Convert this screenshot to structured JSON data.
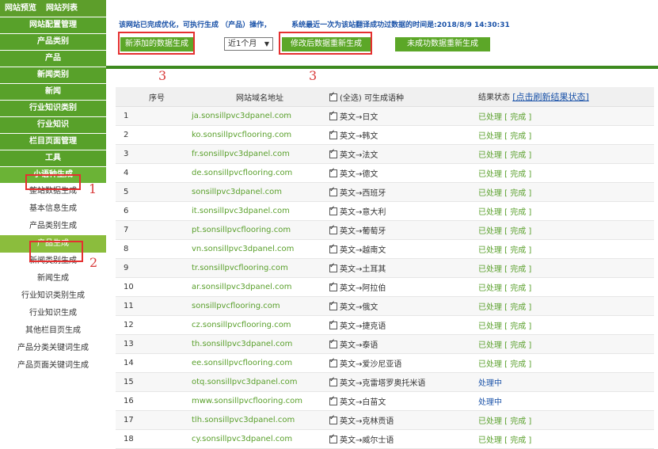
{
  "sidebar": {
    "tabs": [
      "网站预览",
      "网站列表"
    ],
    "groups": [
      "网站配置管理",
      "产品类别",
      "产品",
      "新闻类别",
      "新闻",
      "行业知识类别",
      "行业知识",
      "栏目页面管理",
      "工具",
      "小语种生成"
    ],
    "items": [
      "整站数据生成",
      "基本信息生成",
      "产品类别生成",
      "产品生成",
      "新闻类别生成",
      "新闻生成",
      "行业知识类别生成",
      "行业知识生成",
      "其他栏目页生成",
      "产品分类关键词生成",
      "产品页面关键词生成"
    ]
  },
  "notice": {
    "part1": "该网站已完成优化，可执行生成 （产品）操作，",
    "part2": "系统最近一次为该站翻译成功过数据的时间是:2018/8/9 14:30:31"
  },
  "toolbar": {
    "new_btn": "新添加的数据生成",
    "period": "近1个月",
    "modified_btn": "修改后数据重新生成",
    "failed_btn": "未成功数据重新生成"
  },
  "annotations": {
    "n1": "1",
    "n2": "2",
    "n3a": "3",
    "n3b": "3"
  },
  "table": {
    "headers": {
      "no": "序号",
      "domain": "网站域名地址",
      "langs": "(全选) 可生成语种",
      "status": "结果状态",
      "refresh": "[点击刷新结果状态]"
    },
    "rows": [
      {
        "no": "1",
        "domain": "ja.sonsillpvc3dpanel.com",
        "lang": "英文→日文",
        "status": "已处理 [ 完成 ]"
      },
      {
        "no": "2",
        "domain": "ko.sonsillpvcflooring.com",
        "lang": "英文→韩文",
        "status": "已处理 [ 完成 ]"
      },
      {
        "no": "3",
        "domain": "fr.sonsillpvc3dpanel.com",
        "lang": "英文→法文",
        "status": "已处理 [ 完成 ]"
      },
      {
        "no": "4",
        "domain": "de.sonsillpvcflooring.com",
        "lang": "英文→德文",
        "status": "已处理 [ 完成 ]"
      },
      {
        "no": "5",
        "domain": "sonsillpvc3dpanel.com",
        "lang": "英文→西班牙",
        "status": "已处理 [ 完成 ]"
      },
      {
        "no": "6",
        "domain": "it.sonsillpvc3dpanel.com",
        "lang": "英文→意大利",
        "status": "已处理 [ 完成 ]"
      },
      {
        "no": "7",
        "domain": "pt.sonsillpvcflooring.com",
        "lang": "英文→葡萄牙",
        "status": "已处理 [ 完成 ]"
      },
      {
        "no": "8",
        "domain": "vn.sonsillpvc3dpanel.com",
        "lang": "英文→越南文",
        "status": "已处理 [ 完成 ]"
      },
      {
        "no": "9",
        "domain": "tr.sonsillpvcflooring.com",
        "lang": "英文→土耳其",
        "status": "已处理 [ 完成 ]"
      },
      {
        "no": "10",
        "domain": "ar.sonsillpvc3dpanel.com",
        "lang": "英文→阿拉伯",
        "status": "已处理 [ 完成 ]"
      },
      {
        "no": "11",
        "domain": "sonsillpvcflooring.com",
        "lang": "英文→俄文",
        "status": "已处理 [ 完成 ]"
      },
      {
        "no": "12",
        "domain": "cz.sonsillpvcflooring.com",
        "lang": "英文→捷克语",
        "status": "已处理 [ 完成 ]"
      },
      {
        "no": "13",
        "domain": "th.sonsillpvc3dpanel.com",
        "lang": "英文→泰语",
        "status": "已处理 [ 完成 ]"
      },
      {
        "no": "14",
        "domain": "ee.sonsillpvcflooring.com",
        "lang": "英文→爱沙尼亚语",
        "status": "已处理 [ 完成 ]"
      },
      {
        "no": "15",
        "domain": "otq.sonsillpvc3dpanel.com",
        "lang": "英文→克雷塔罗奥托米语",
        "status": "处理中"
      },
      {
        "no": "16",
        "domain": "mww.sonsillpvcflooring.com",
        "lang": "英文→白苗文",
        "status": "处理中"
      },
      {
        "no": "17",
        "domain": "tlh.sonsillpvc3dpanel.com",
        "lang": "英文→克林贡语",
        "status": "已处理 [ 完成 ]"
      },
      {
        "no": "18",
        "domain": "cy.sonsillpvc3dpanel.com",
        "lang": "英文→威尔士语",
        "status": "已处理 [ 完成 ]"
      }
    ]
  },
  "colors": {
    "green": "#58a12a",
    "blue_text": "#1a52a8",
    "red_annotation": "#e53030"
  }
}
